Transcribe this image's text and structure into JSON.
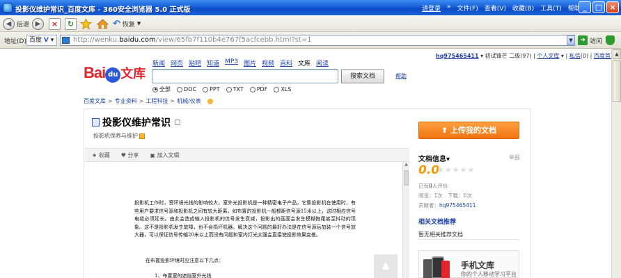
{
  "window": {
    "title": "投影仪维护常识_百度文库 - 360安全浏览器 5.0 正式版",
    "menu": [
      "请登录",
      "»",
      "文件(F)",
      "查看(V)",
      "收藏(B)",
      "工具(T)",
      "帮助(H)"
    ]
  },
  "toolbar": {
    "back": "后退",
    "restore": "恢复"
  },
  "address": {
    "label": "地址(D)",
    "engine": "百度",
    "url_prefix": "http://wenku.",
    "url_host": "baidu.com",
    "url_suffix": "/view/65fb7f110b4e767f5acfcebb.html?st=1",
    "go": "访问"
  },
  "userbar": {
    "username": "hq975465411",
    "level": "▾ 初试锋芒 二级(97) |",
    "my_wenku": "个人文库",
    "messages": "私信",
    "msg_count": "(0) |",
    "home": "百度首页"
  },
  "logo": {
    "bai": "Bai",
    "paw": "du",
    "wenku": "文库"
  },
  "nav": [
    "新闻",
    "网页",
    "贴吧",
    "知道",
    "MP3",
    "图片",
    "视频",
    "百科",
    "文库",
    "阅读"
  ],
  "search": {
    "value": "",
    "button": "搜索文档",
    "help": "帮助",
    "filters": [
      "全部",
      "DOC",
      "PPT",
      "TXT",
      "PDF",
      "XLS"
    ]
  },
  "breadcrumb": [
    "百度文库",
    ">",
    "专业资料",
    ">",
    "工程科技",
    ">",
    "机械/仪表"
  ],
  "document": {
    "title": "投影仪维护常识",
    "subtitle": "投影机保养与维护",
    "actions": [
      "★ 收藏",
      "♥ 分享",
      "▣ 加入文辑"
    ],
    "body": "投影机工作时，受环境光线的影响较大，室外光投影机是一种精密电子产品，它集投影机在使用时，有些用户要求信号源和投影机之间有较大距离，如布置的投影机一般都距信号源15米以上，这时相应信号电缆必须延长。由此会造成输入投影机的信号发生衰减，投影出的画面会发生模糊拖尾甚至抖动的现象。这不是投影机发生故障，也不会损坏机器。解决这个问题的最好办法是在信号源后加装一个信号放大器，可以保证信号传输20米以上而没有问题和室内灯光太强会直接使投影效果变差。",
    "line2": "在布置投影环境时应注意以下几点：",
    "line3": "1、布置室的遮挡室外光线"
  },
  "sidebar": {
    "upload": "上传我的文档",
    "info_title": "文档信息▾",
    "report": "举报",
    "score": "0.0",
    "stars": [
      "★",
      "★",
      "★",
      "★",
      "★"
    ],
    "rated_prefix": "已有",
    "rated_count": "0",
    "rated_suffix": "人评价",
    "views": "阅览：1次",
    "downloads": "下载：0次",
    "contributor_label": "贡献者：",
    "contributor": "hq975465411",
    "related_title": "相关文档推荐",
    "related_none": "暂无相关推荐文档",
    "mobile_title": "手机文库",
    "mobile_sub": "你的个人移动学习平台"
  },
  "icons": [
    "app-icon",
    "back-icon",
    "forward-icon",
    "stop-icon",
    "refresh-icon",
    "favorites-icon",
    "home-icon",
    "restore-icon",
    "go-icon",
    "shield-icon"
  ]
}
